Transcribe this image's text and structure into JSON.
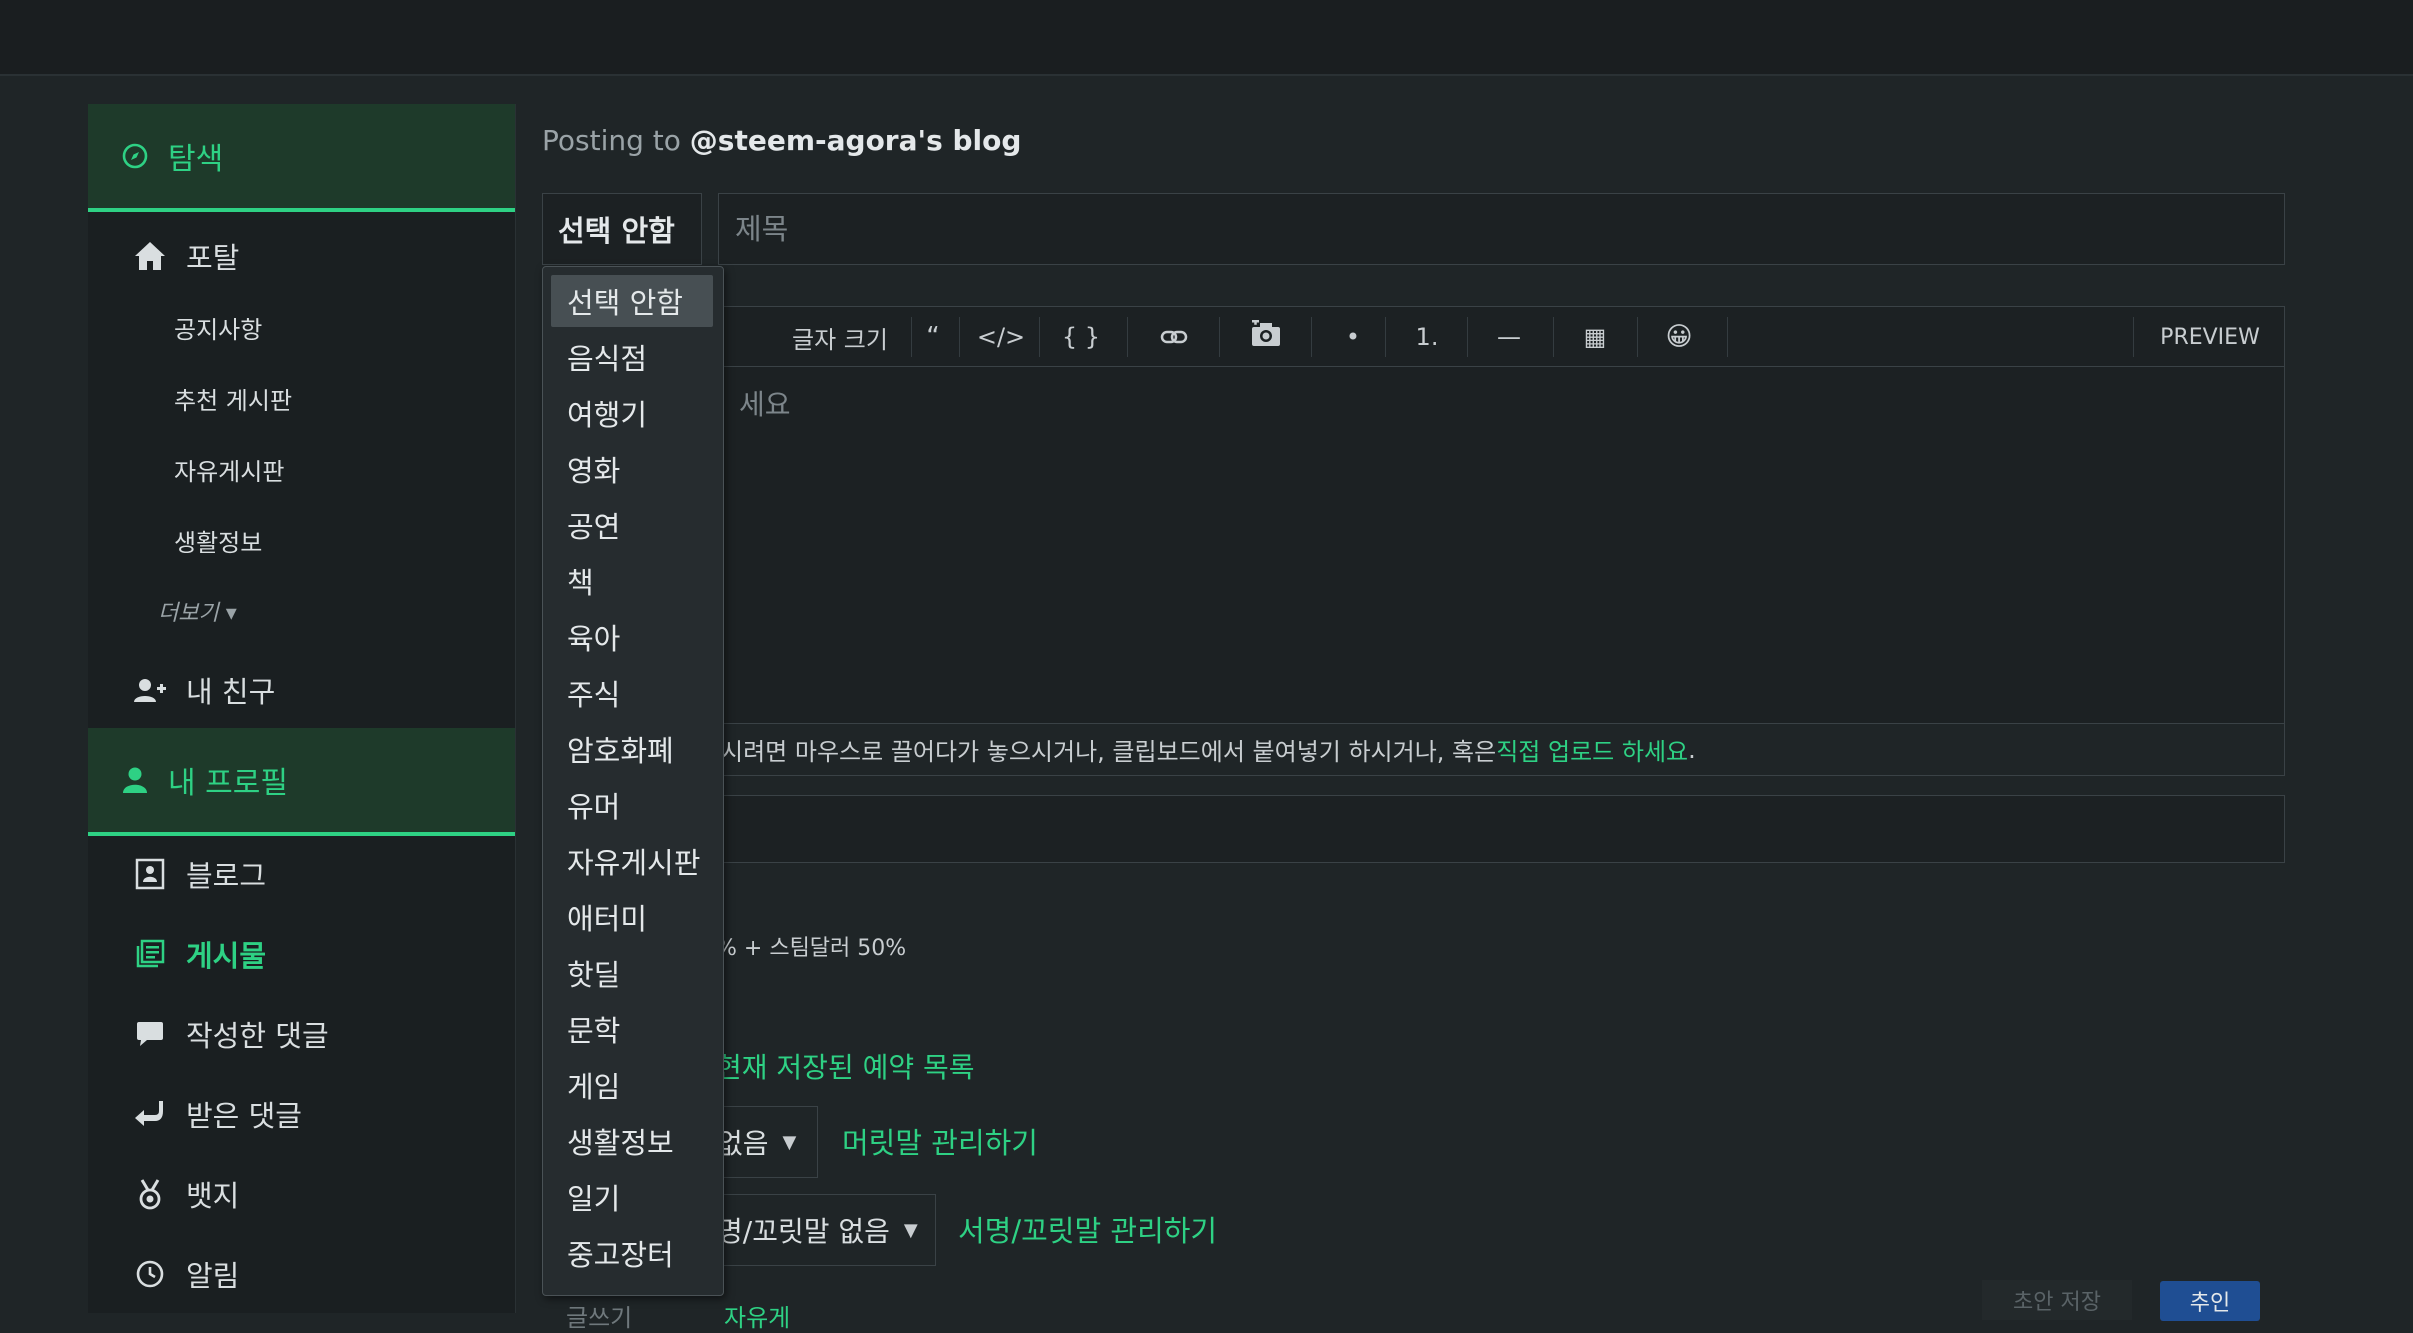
{
  "sidebar": {
    "explore": "탐색",
    "portal": "포탈",
    "sub_items": [
      "공지사항",
      "추천 게시판",
      "자유게시판",
      "생활정보"
    ],
    "more": "더보기 ▾",
    "friends": "내 친구",
    "profile": "내 프로필",
    "blog": "블로그",
    "posts": "게시물",
    "my_comments": "작성한 댓글",
    "replies": "받은 댓글",
    "badges": "뱃지",
    "notifications": "알림"
  },
  "editor": {
    "posting_prefix": "Posting to ",
    "posting_target": "@steem-agora's blog",
    "category_value": "선택 안함",
    "title_placeholder": "제목",
    "toolbar": {
      "font_size": "글자 크기",
      "quote": "“",
      "code": "</>",
      "braces": "{ }",
      "bullet": "•",
      "numbered": "1.",
      "hr": "—",
      "table": "▦",
      "emoji": "😀",
      "preview": "PREVIEW"
    },
    "body_placeholder": "세요",
    "upload_hint": "시려면 마우스로 끌어다가 놓으시거나, 클립보드에서 붙여넣기 하시거나, 혹은 ",
    "upload_link": "직접 업로드 하세요",
    "upload_end": "."
  },
  "options": {
    "reward": "% + 스팀달러 50%",
    "schedule_link": "현재 저장된 예약 목록",
    "header_select": "없음",
    "header_manage": "머릿말 관리하기",
    "signature_select": "명/꼬릿말 없음",
    "signature_manage": "서명/꼬릿말 관리하기",
    "bottom_left": "글쓰기",
    "bottom_mid": "자유게",
    "draft_button": "초안 저장",
    "submit_button": "추인"
  },
  "dropdown": {
    "options": [
      "선택 안함",
      "음식점",
      "여행기",
      "영화",
      "공연",
      "책",
      "육아",
      "주식",
      "암호화폐",
      "유머",
      "자유게시판",
      "애터미",
      "핫딜",
      "문학",
      "게임",
      "생활정보",
      "일기",
      "중고장터"
    ],
    "selected_index": 0
  },
  "colors": {
    "accent": "#2ed184",
    "background": "#1f2527",
    "submit": "#1f4e93"
  }
}
